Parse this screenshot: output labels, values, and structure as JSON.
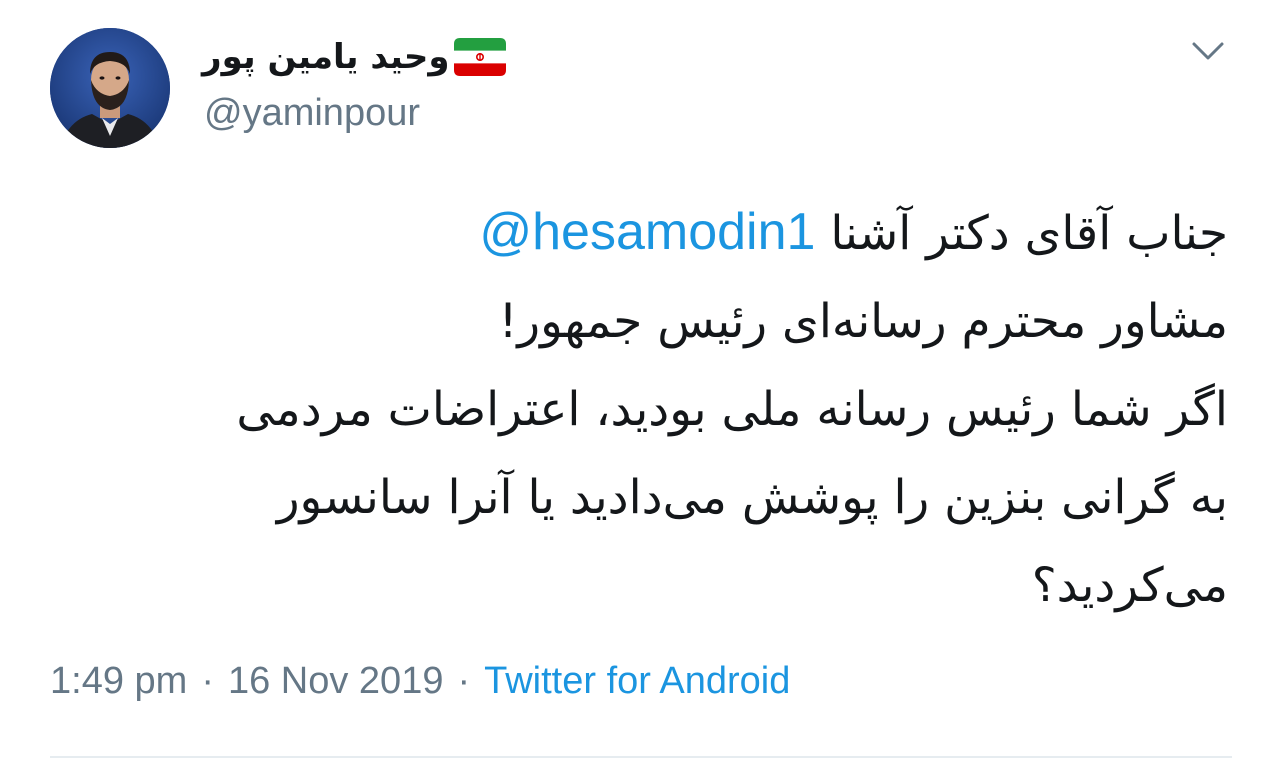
{
  "user": {
    "display_name": "وحید یامین پور",
    "handle": "@yaminpour",
    "flag": "iran-flag-icon"
  },
  "tweet": {
    "line1_prefix": "جناب آقای دکتر آشنا ",
    "mention": "@hesamodin1",
    "line2": "مشاور محترم رسانه‌ای رئیس جمهور!",
    "line3": "اگر شما رئیس رسانه ملی بودید، اعتراضات مردمی",
    "line4": "به گرانی بنزین را پوشش می‌دادید یا آنرا سانسور",
    "line5": "می‌کردید؟"
  },
  "meta": {
    "time": "1:49 pm",
    "separator": "·",
    "date": "16 Nov 2019",
    "source": "Twitter for Android"
  },
  "colors": {
    "link": "#1b95e0",
    "secondary": "#657786",
    "text": "#14171a",
    "divider": "#e6ecf0"
  }
}
